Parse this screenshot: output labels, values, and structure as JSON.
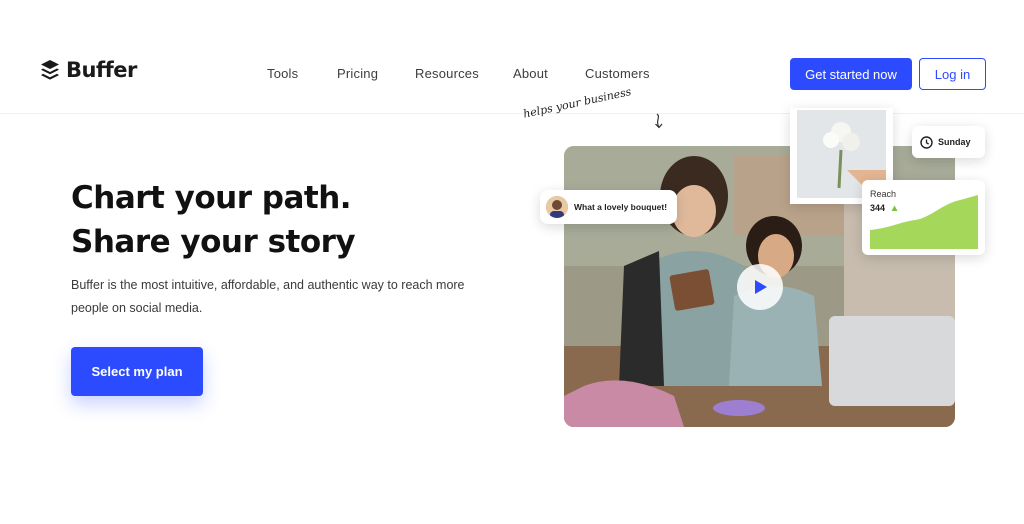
{
  "brand": {
    "name": "Buffer",
    "accent": "#2c4bff"
  },
  "nav": {
    "items": [
      {
        "label": "Tools"
      },
      {
        "label": "Pricing"
      },
      {
        "label": "Resources"
      },
      {
        "label": "About"
      },
      {
        "label": "Customers"
      }
    ],
    "cta_label": "Get started now",
    "login_label": "Log in"
  },
  "hero": {
    "title_line1": "Chart your path.",
    "title_line2": "Share your story",
    "subtitle": "Buffer is the most intuitive, affordable, and authentic way to reach more people on social media.",
    "cta_label": "Select my plan"
  },
  "media": {
    "handwritten": "helps your business",
    "comment_text": "What a lovely bouquet!",
    "schedule_day": "Sunday",
    "reach_label": "Reach",
    "reach_value": "344",
    "chart_color": "#a5d85a",
    "icons": [
      "play-icon",
      "clock-icon",
      "arrow-up-icon",
      "squiggle-arrow-icon"
    ]
  }
}
